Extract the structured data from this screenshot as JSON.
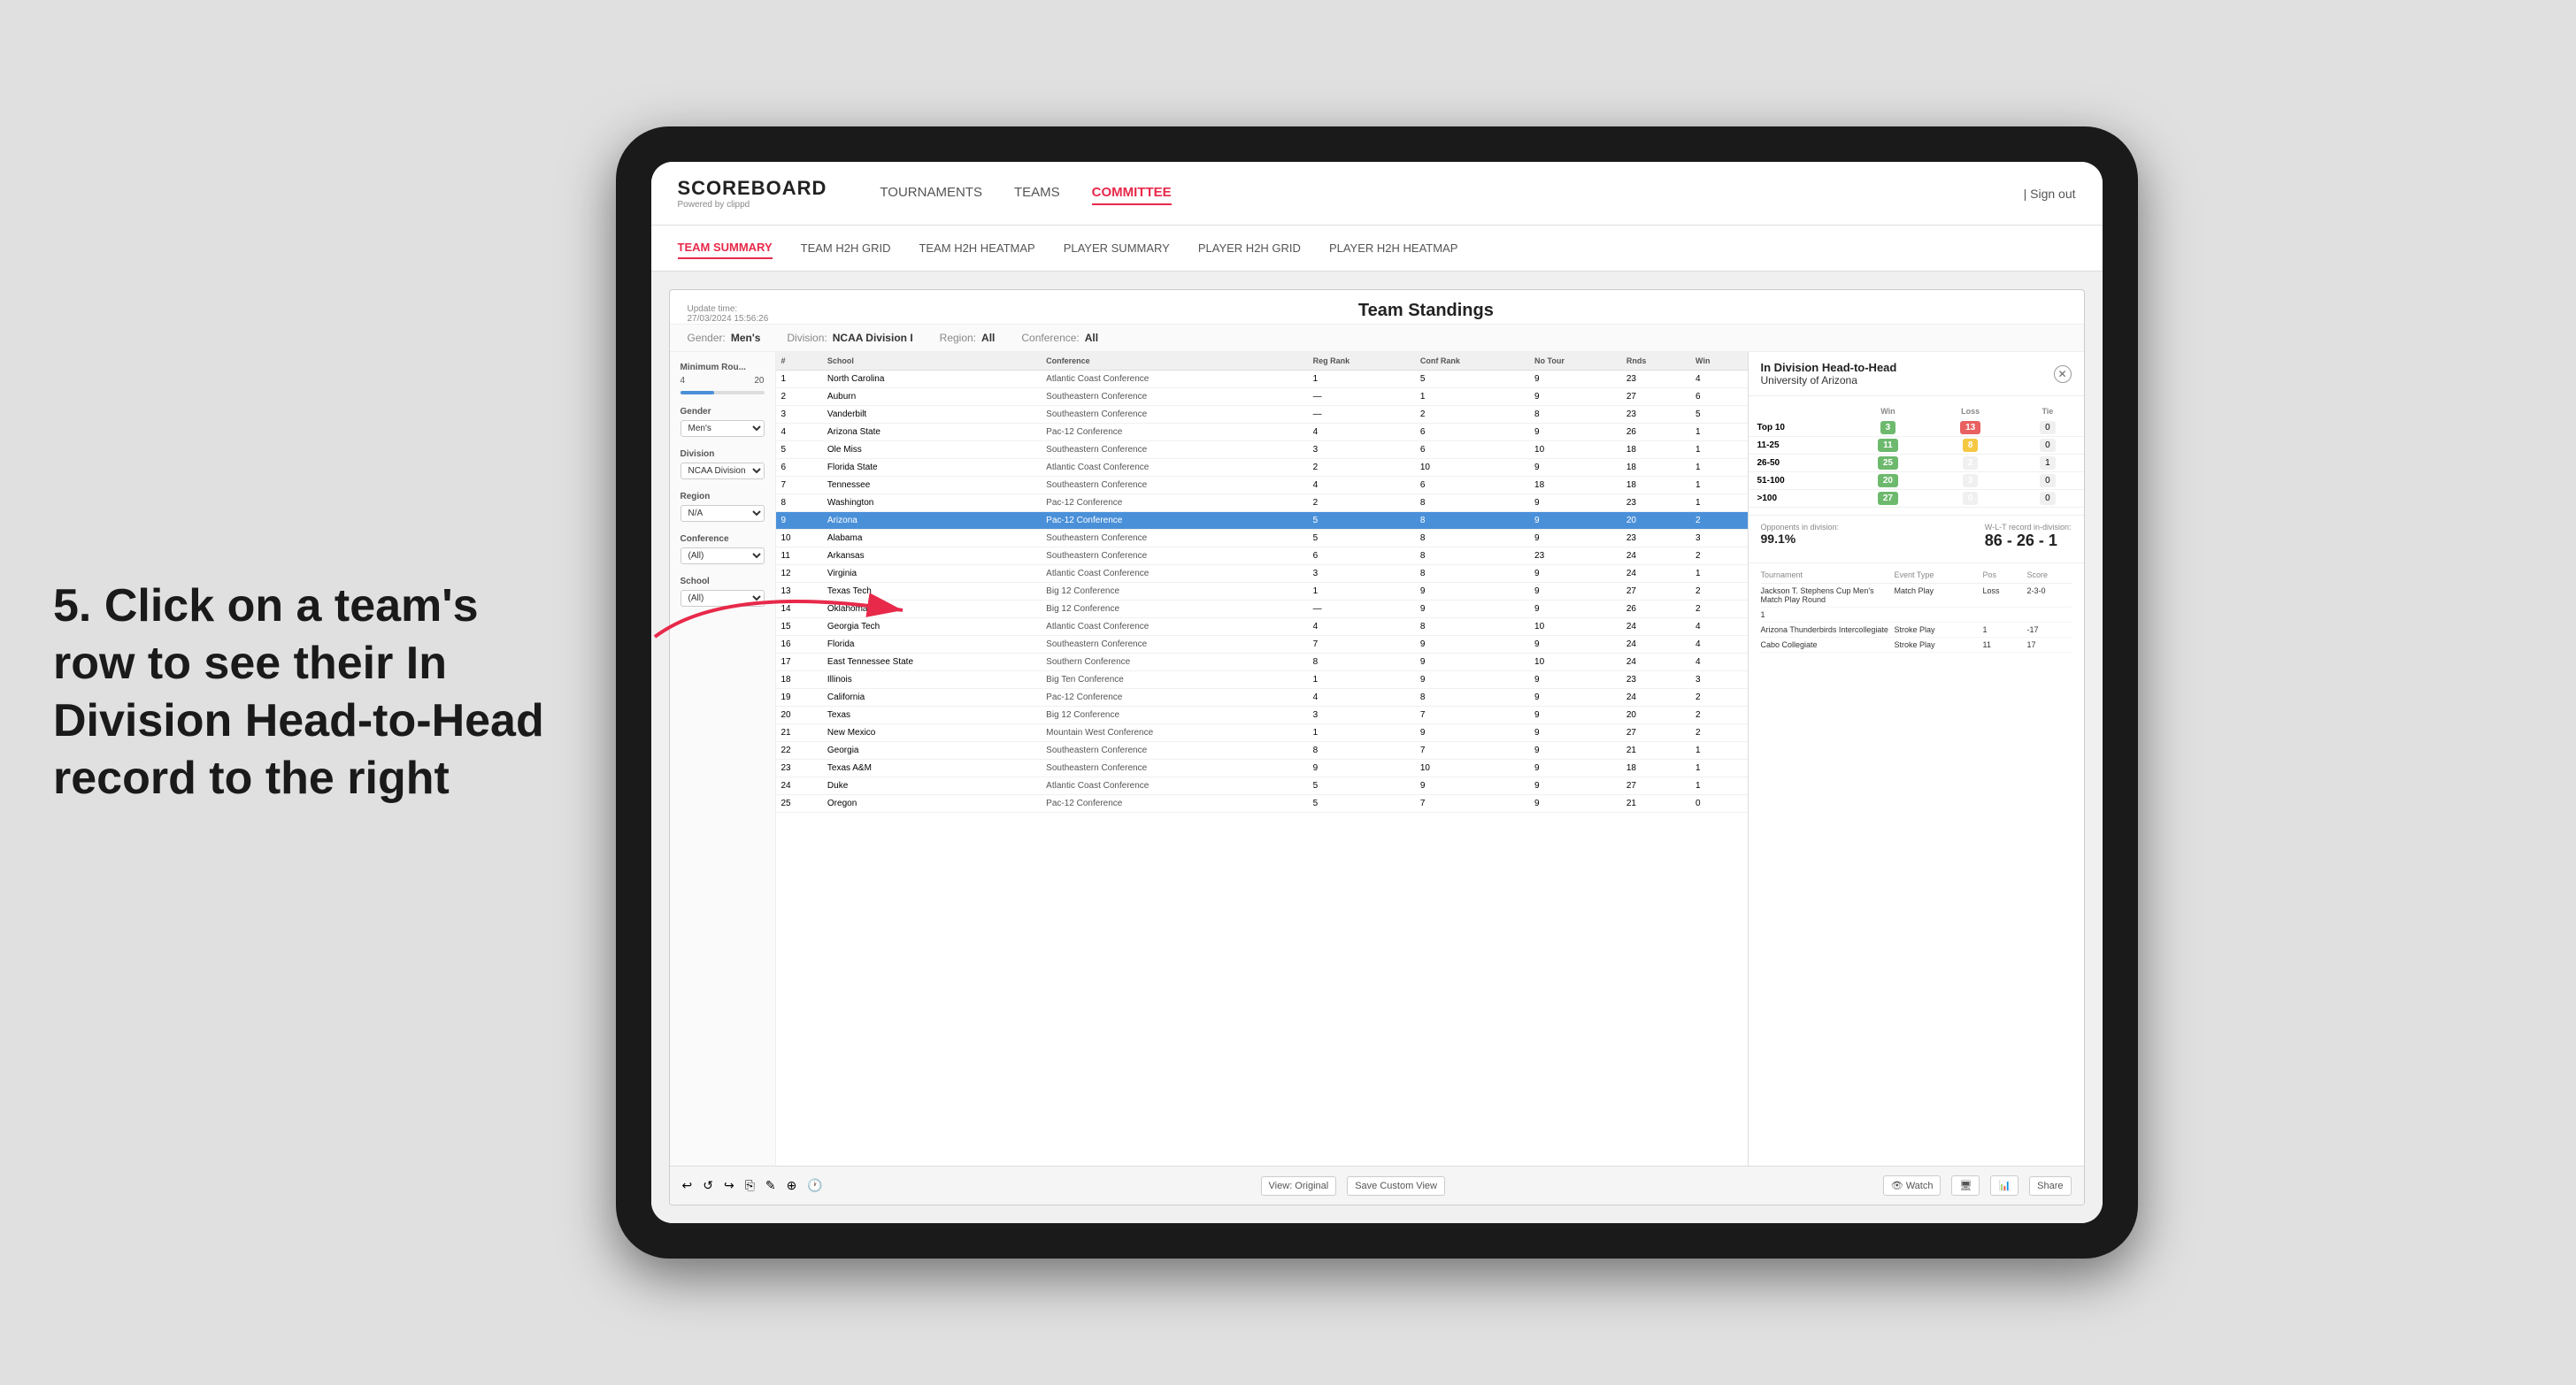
{
  "instruction": {
    "step": "5.",
    "text": "Click on a team's row to see their In Division Head-to-Head record to the right"
  },
  "nav": {
    "logo": "SCOREBOARD",
    "logo_sub": "Powered by clippd",
    "items": [
      "TOURNAMENTS",
      "TEAMS",
      "COMMITTEE"
    ],
    "sign_out": "Sign out"
  },
  "sub_nav": {
    "items": [
      "TEAM SUMMARY",
      "TEAM H2H GRID",
      "TEAM H2H HEATMAP",
      "PLAYER SUMMARY",
      "PLAYER H2H GRID",
      "PLAYER H2H HEATMAP"
    ]
  },
  "panel": {
    "title": "Team Standings",
    "update_label": "Update time:",
    "update_time": "27/03/2024 15:56:26",
    "filters": {
      "gender_label": "Gender:",
      "gender_value": "Men's",
      "division_label": "Division:",
      "division_value": "NCAA Division I",
      "region_label": "Region:",
      "region_value": "All",
      "conference_label": "Conference:",
      "conference_value": "All"
    }
  },
  "sidebar": {
    "min_rounds_label": "Minimum Rou...",
    "min_rounds_val": "4",
    "gender_label": "Gender",
    "gender_val": "Men's",
    "division_label": "Division",
    "division_val": "NCAA Division I",
    "region_label": "Region",
    "region_val": "N/A",
    "conference_label": "Conference",
    "conference_val": "(All)",
    "school_label": "School",
    "school_val": "(All)"
  },
  "table": {
    "headers": [
      "#",
      "School",
      "Conference",
      "Reg Rank",
      "Conf Rank",
      "No Tour",
      "Rnds",
      "Win"
    ],
    "rows": [
      {
        "rank": "1",
        "school": "North Carolina",
        "conf": "Atlantic Coast Conference",
        "reg": "1",
        "crank": "5",
        "ntour": "9",
        "rnds": "23",
        "win": "4"
      },
      {
        "rank": "2",
        "school": "Auburn",
        "conf": "Southeastern Conference",
        "reg": "—",
        "crank": "1",
        "ntour": "9",
        "rnds": "27",
        "win": "6"
      },
      {
        "rank": "3",
        "school": "Vanderbilt",
        "conf": "Southeastern Conference",
        "reg": "—",
        "crank": "2",
        "ntour": "8",
        "rnds": "23",
        "win": "5"
      },
      {
        "rank": "4",
        "school": "Arizona State",
        "conf": "Pac-12 Conference",
        "reg": "4",
        "crank": "6",
        "ntour": "9",
        "rnds": "26",
        "win": "1"
      },
      {
        "rank": "5",
        "school": "Ole Miss",
        "conf": "Southeastern Conference",
        "reg": "3",
        "crank": "6",
        "ntour": "10",
        "rnds": "18",
        "win": "1"
      },
      {
        "rank": "6",
        "school": "Florida State",
        "conf": "Atlantic Coast Conference",
        "reg": "2",
        "crank": "10",
        "ntour": "9",
        "rnds": "18",
        "win": "1"
      },
      {
        "rank": "7",
        "school": "Tennessee",
        "conf": "Southeastern Conference",
        "reg": "4",
        "crank": "6",
        "ntour": "18",
        "rnds": "18",
        "win": "1"
      },
      {
        "rank": "8",
        "school": "Washington",
        "conf": "Pac-12 Conference",
        "reg": "2",
        "crank": "8",
        "ntour": "9",
        "rnds": "23",
        "win": "1"
      },
      {
        "rank": "9",
        "school": "Arizona",
        "conf": "Pac-12 Conference",
        "reg": "5",
        "crank": "8",
        "ntour": "9",
        "rnds": "20",
        "win": "2",
        "highlighted": true
      },
      {
        "rank": "10",
        "school": "Alabama",
        "conf": "Southeastern Conference",
        "reg": "5",
        "crank": "8",
        "ntour": "9",
        "rnds": "23",
        "win": "3"
      },
      {
        "rank": "11",
        "school": "Arkansas",
        "conf": "Southeastern Conference",
        "reg": "6",
        "crank": "8",
        "ntour": "23",
        "rnds": "24",
        "win": "2"
      },
      {
        "rank": "12",
        "school": "Virginia",
        "conf": "Atlantic Coast Conference",
        "reg": "3",
        "crank": "8",
        "ntour": "9",
        "rnds": "24",
        "win": "1"
      },
      {
        "rank": "13",
        "school": "Texas Tech",
        "conf": "Big 12 Conference",
        "reg": "1",
        "crank": "9",
        "ntour": "9",
        "rnds": "27",
        "win": "2"
      },
      {
        "rank": "14",
        "school": "Oklahoma",
        "conf": "Big 12 Conference",
        "reg": "—",
        "crank": "9",
        "ntour": "9",
        "rnds": "26",
        "win": "2"
      },
      {
        "rank": "15",
        "school": "Georgia Tech",
        "conf": "Atlantic Coast Conference",
        "reg": "4",
        "crank": "8",
        "ntour": "10",
        "rnds": "24",
        "win": "4"
      },
      {
        "rank": "16",
        "school": "Florida",
        "conf": "Southeastern Conference",
        "reg": "7",
        "crank": "9",
        "ntour": "9",
        "rnds": "24",
        "win": "4"
      },
      {
        "rank": "17",
        "school": "East Tennessee State",
        "conf": "Southern Conference",
        "reg": "8",
        "crank": "9",
        "ntour": "10",
        "rnds": "24",
        "win": "4"
      },
      {
        "rank": "18",
        "school": "Illinois",
        "conf": "Big Ten Conference",
        "reg": "1",
        "crank": "9",
        "ntour": "9",
        "rnds": "23",
        "win": "3"
      },
      {
        "rank": "19",
        "school": "California",
        "conf": "Pac-12 Conference",
        "reg": "4",
        "crank": "8",
        "ntour": "9",
        "rnds": "24",
        "win": "2"
      },
      {
        "rank": "20",
        "school": "Texas",
        "conf": "Big 12 Conference",
        "reg": "3",
        "crank": "7",
        "ntour": "9",
        "rnds": "20",
        "win": "2"
      },
      {
        "rank": "21",
        "school": "New Mexico",
        "conf": "Mountain West Conference",
        "reg": "1",
        "crank": "9",
        "ntour": "9",
        "rnds": "27",
        "win": "2"
      },
      {
        "rank": "22",
        "school": "Georgia",
        "conf": "Southeastern Conference",
        "reg": "8",
        "crank": "7",
        "ntour": "9",
        "rnds": "21",
        "win": "1"
      },
      {
        "rank": "23",
        "school": "Texas A&M",
        "conf": "Southeastern Conference",
        "reg": "9",
        "crank": "10",
        "ntour": "9",
        "rnds": "18",
        "win": "1"
      },
      {
        "rank": "24",
        "school": "Duke",
        "conf": "Atlantic Coast Conference",
        "reg": "5",
        "crank": "9",
        "ntour": "9",
        "rnds": "27",
        "win": "1"
      },
      {
        "rank": "25",
        "school": "Oregon",
        "conf": "Pac-12 Conference",
        "reg": "5",
        "crank": "7",
        "ntour": "9",
        "rnds": "21",
        "win": "0"
      }
    ]
  },
  "h2h_panel": {
    "title": "In Division Head-to-Head",
    "team": "University of Arizona",
    "win_label": "Win",
    "loss_label": "Loss",
    "tie_label": "Tie",
    "rows": [
      {
        "label": "Top 10",
        "win": "3",
        "loss": "13",
        "tie": "0",
        "win_color": "green",
        "loss_color": "red"
      },
      {
        "label": "11-25",
        "win": "11",
        "loss": "8",
        "tie": "0",
        "win_color": "green",
        "loss_color": "yellow"
      },
      {
        "label": "26-50",
        "win": "25",
        "loss": "2",
        "tie": "1",
        "win_color": "green",
        "loss_color": "zero"
      },
      {
        "label": "51-100",
        "win": "20",
        "loss": "3",
        "tie": "0",
        "win_color": "green",
        "loss_color": "zero"
      },
      {
        "label": ">100",
        "win": "27",
        "loss": "0",
        "tie": "0",
        "win_color": "green",
        "loss_color": "zero"
      }
    ],
    "opponents_label": "Opponents in division:",
    "opponents_value": "99.1%",
    "wl_label": "W-L-T record in-division:",
    "wl_value": "86 - 26 - 1",
    "tournament_columns": [
      "Tournament",
      "Event Type",
      "Pos",
      "Score"
    ],
    "tournaments": [
      {
        "name": "Jackson T. Stephens Cup Men's Match Play Round",
        "type": "Match Play",
        "result": "Loss",
        "score": "2-3-0"
      },
      {
        "name": "1",
        "type": "",
        "result": "",
        "score": ""
      },
      {
        "name": "Arizona Thunderbirds Intercollegiate",
        "type": "Stroke Play",
        "result": "1",
        "score": "-17"
      },
      {
        "name": "Cabo Collegiate",
        "type": "Stroke Play",
        "result": "11",
        "score": "17"
      }
    ]
  },
  "toolbar": {
    "buttons": [
      "↩",
      "↺",
      "↪",
      "⎘",
      "✎",
      "⊕",
      "🕐",
      "View: Original",
      "Save Custom View",
      "Watch",
      "🖥",
      "📊",
      "Share"
    ]
  },
  "colors": {
    "accent": "#e8294a",
    "highlight_row": "#4a90d9",
    "cell_green": "#6db96d",
    "cell_red": "#e86060",
    "cell_yellow": "#f5c842"
  }
}
